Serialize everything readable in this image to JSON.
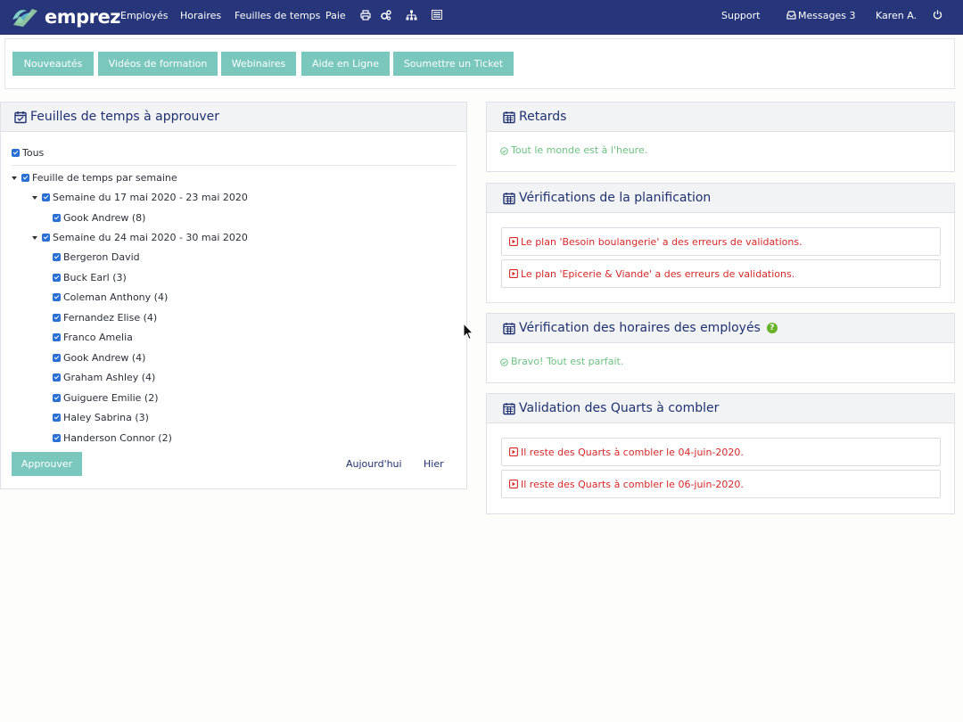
{
  "nav": {
    "brand": "emprez",
    "links": [
      "Employés",
      "Horaires",
      "Feuilles de temps",
      "Paie"
    ],
    "icons": [
      "printer-icon",
      "cogs-icon",
      "sitemap-icon",
      "list-icon"
    ],
    "support": "Support",
    "messages_label": "Messages",
    "messages_count": "3",
    "user": "Karen A.",
    "colors": {
      "bar": "#27367a",
      "accent": "#79c7bd"
    }
  },
  "toolbar": {
    "buttons": [
      "Nouveautés",
      "Vidéos de formation",
      "Webinaires",
      "Aide en Ligne",
      "Soumettre un Ticket"
    ]
  },
  "timesheets": {
    "title": "Feuilles de temps à approuver",
    "all_label": "Tous",
    "group_label": "Feuille de temps par semaine",
    "weeks": [
      {
        "label": "Semaine du 17 mai 2020 - 23 mai 2020",
        "employees": [
          "Gook Andrew (8)"
        ]
      },
      {
        "label": "Semaine du 24 mai 2020 - 30 mai 2020",
        "employees": [
          "Bergeron David",
          "Buck Earl (3)",
          "Coleman Anthony (4)",
          "Fernandez Elise (4)",
          "Franco Amelia",
          "Gook Andrew (4)",
          "Graham Ashley (4)",
          "Guiguere Emilie (2)",
          "Haley Sabrina (3)",
          "Handerson Connor (2)"
        ]
      }
    ],
    "approve_label": "Approuver",
    "today_label": "Aujourd'hui",
    "yesterday_label": "Hier"
  },
  "delays": {
    "title": "Retards",
    "message": "Tout le monde est à l'heure."
  },
  "planning": {
    "title": "Vérifications de la planification",
    "errors": [
      "Le plan 'Besoin boulangerie' a des erreurs de validations.",
      "Le plan 'Epicerie & Viande' a des erreurs de validations."
    ]
  },
  "schedules": {
    "title": "Vérification des horaires des employés",
    "help": "?",
    "message": "Bravo! Tout est parfait."
  },
  "shifts": {
    "title": "Validation des Quarts à combler",
    "errors": [
      "Il reste des Quarts à combler le 04-juin-2020.",
      "Il reste des Quarts à combler le 06-juin-2020."
    ]
  }
}
